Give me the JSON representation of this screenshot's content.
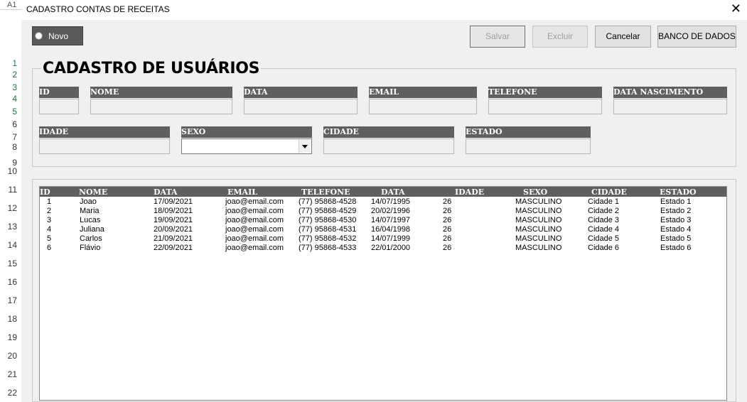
{
  "excel": {
    "cell_ref": "A1",
    "rows": [
      "1",
      "2",
      "3",
      "4",
      "5",
      "6",
      "7",
      "8",
      "9",
      "10",
      "11",
      "12",
      "13",
      "14",
      "15",
      "16",
      "17",
      "18",
      "19",
      "20",
      "21",
      "22"
    ]
  },
  "window": {
    "title": "CADASTRO CONTAS DE RECEITAS",
    "close": "✕"
  },
  "toolbar": {
    "novo_label": "Novo",
    "salvar_label": "Salvar",
    "excluir_label": "Excluir",
    "cancelar_label": "Cancelar",
    "banco_label": "BANCO DE DADOS"
  },
  "form": {
    "title": "CADASTRO DE USUÁRIOS",
    "fields": {
      "id": "ID",
      "nome": "NOME",
      "data": "DATA",
      "email": "EMAIL",
      "telefone": "TELEFONE",
      "data_nascimento": "DATA NASCIMENTO",
      "idade": "IDADE",
      "sexo": "SEXO",
      "cidade": "CIDADE",
      "estado": "ESTADO"
    },
    "sexo_value": ""
  },
  "table": {
    "headers": [
      "ID",
      "NOME",
      "DATA",
      "EMAIL",
      "TELEFONE",
      "DATA",
      "IDADE",
      "SEXO",
      "CIDADE",
      "ESTADO"
    ],
    "rows": [
      [
        "1",
        "Joao",
        "17/09/2021",
        "joao@email.com",
        "(77) 95868-4528",
        "14/07/1995",
        "26",
        "MASCULINO",
        "Cidade 1",
        "Estado 1"
      ],
      [
        "2",
        "Maria",
        "18/09/2021",
        "joao@email.com",
        "(77) 95868-4529",
        "20/02/1996",
        "26",
        "MASCULINO",
        "Cidade 2",
        "Estado 2"
      ],
      [
        "3",
        "Lucas",
        "19/09/2021",
        "joao@email.com",
        "(77) 95868-4530",
        "14/07/1997",
        "26",
        "MASCULINO",
        "Cidade 3",
        "Estado 3"
      ],
      [
        "4",
        "Juliana",
        "20/09/2021",
        "joao@email.com",
        "(77) 95868-4531",
        "16/04/1998",
        "26",
        "MASCULINO",
        "Cidade 4",
        "Estado 4"
      ],
      [
        "5",
        "Carlos",
        "21/09/2021",
        "joao@email.com",
        "(77) 95868-4532",
        "14/07/1999",
        "26",
        "MASCULINO",
        "Cidade 5",
        "Estado 5"
      ],
      [
        "6",
        "Flávio",
        "22/09/2021",
        "joao@email.com",
        "(77) 95868-4533",
        "22/01/2000",
        "26",
        "MASCULINO",
        "Cidade 6",
        "Estado 6"
      ]
    ]
  }
}
